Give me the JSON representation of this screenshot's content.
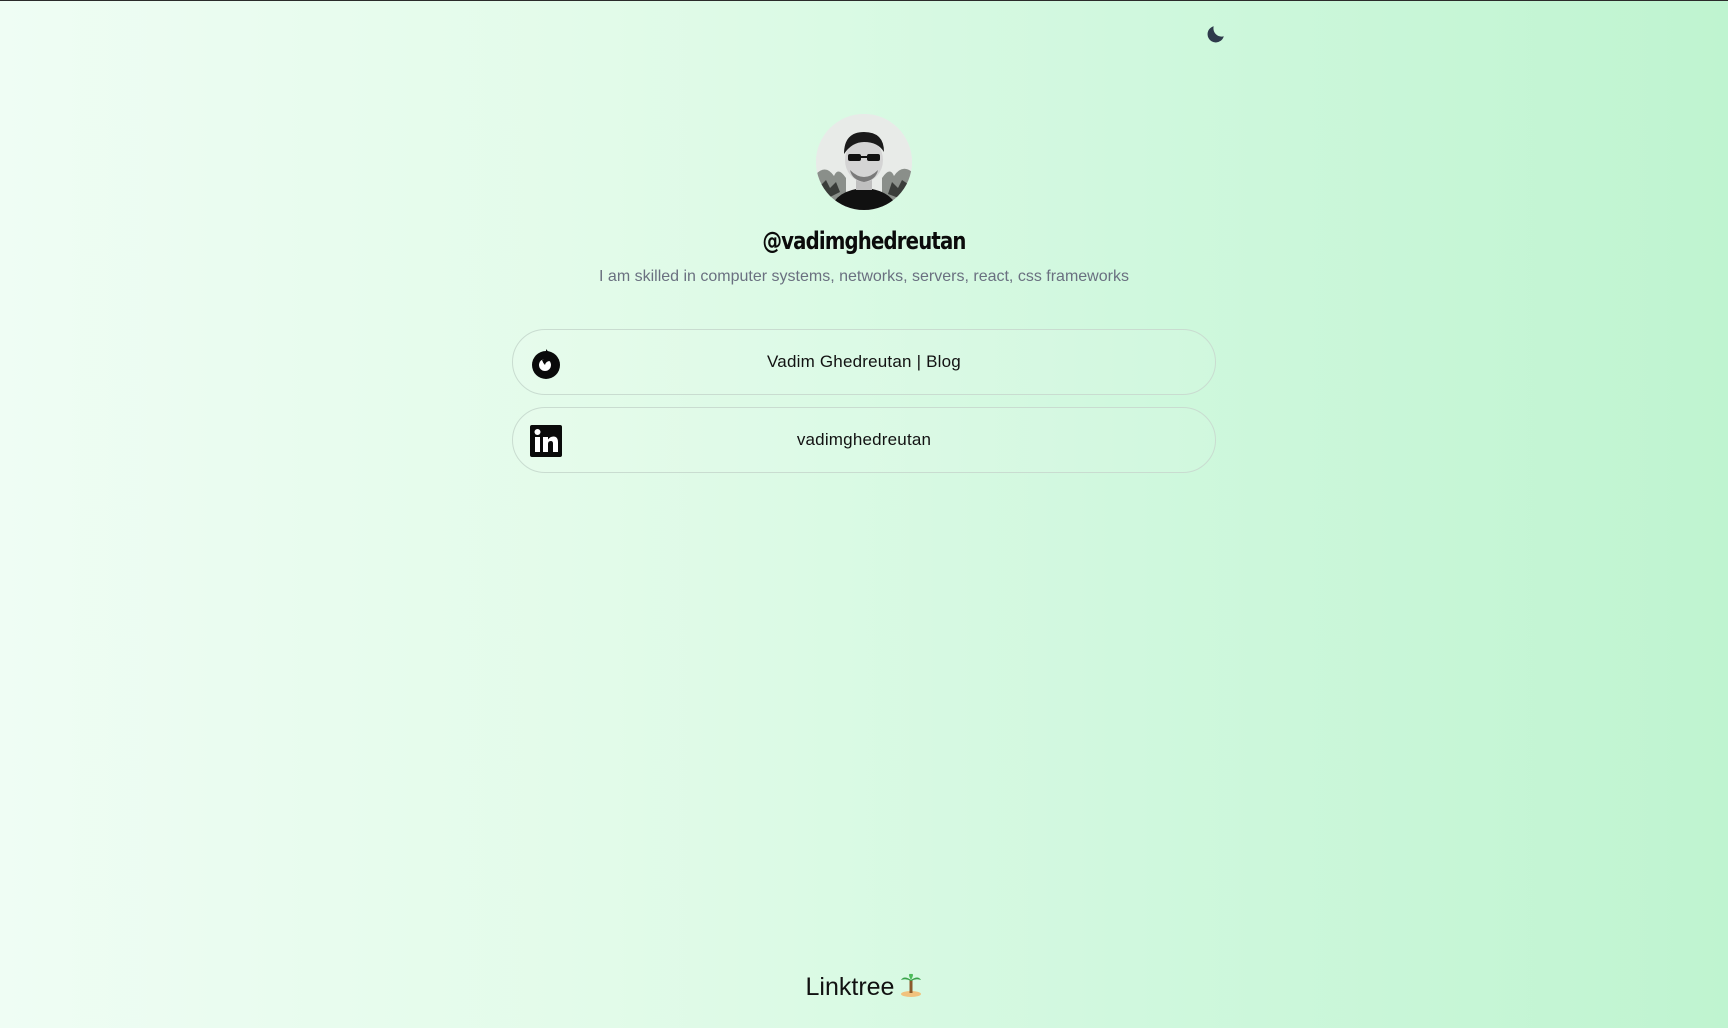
{
  "theme_toggle": {
    "icon": "moon-icon",
    "color": "#2e3a4b"
  },
  "profile": {
    "avatar_icon": "avatar",
    "handle": "@vadimghedreutan",
    "bio": "I am skilled in computer systems, networks, servers, react, css frameworks"
  },
  "links": [
    {
      "label": "Vadim Ghedreutan | Blog",
      "icon": "firefox-icon"
    },
    {
      "label": "vadimghedreutan",
      "icon": "linkedin-icon"
    }
  ],
  "footer": {
    "label": "Linktree",
    "icon": "palm-tree-icon"
  },
  "colors": {
    "text": "#0b0b0b",
    "bio_text": "#6a7080",
    "button_border": "#c9dcd0",
    "bg_left": "#effdf4",
    "bg_right": "#bff4d0"
  }
}
